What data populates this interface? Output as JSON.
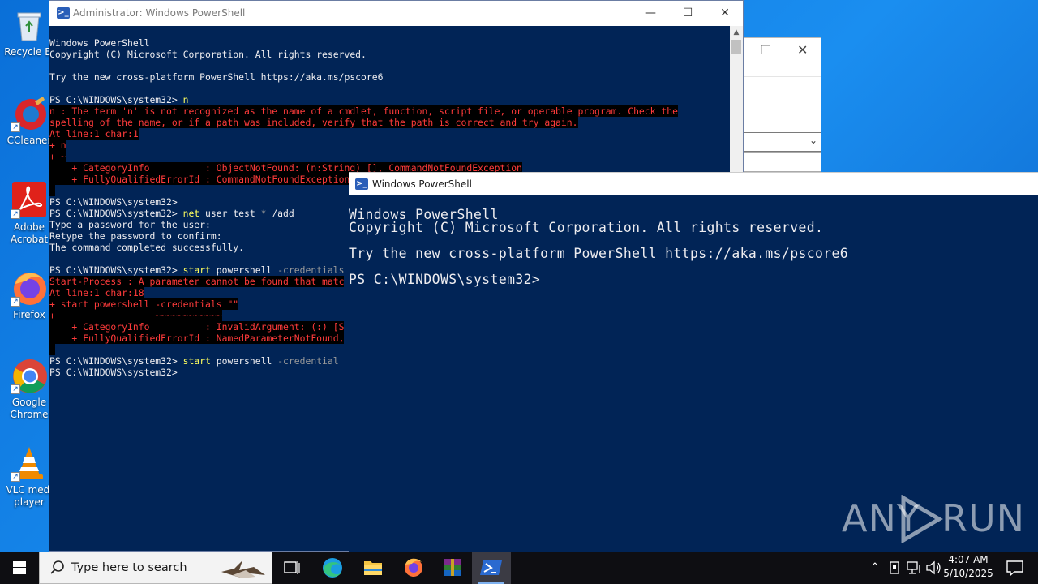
{
  "desktop": {
    "icons": [
      {
        "label": "Recycle Bin",
        "short": "Recycle Bi"
      },
      {
        "label": "CCleaner",
        "short": "CCleaner"
      },
      {
        "label": "Adobe Acrobat",
        "line1": "Adobe",
        "line2": "Acrobat"
      },
      {
        "label": "Firefox",
        "short": "Firefox"
      },
      {
        "label": "Google Chrome",
        "line1": "Google",
        "line2": "Chrome"
      },
      {
        "label": "VLC media player",
        "line1": "VLC medi",
        "line2": "player"
      }
    ]
  },
  "admin_window": {
    "title": "Administrator: Windows PowerShell",
    "lines": {
      "l1": "Windows PowerShell",
      "l2": "Copyright (C) Microsoft Corporation. All rights reserved.",
      "l4": "Try the new cross-platform PowerShell https://aka.ms/pscore6",
      "p1_prompt": "PS C:\\WINDOWS\\system32> ",
      "p1_cmd": "n",
      "e1": "n : The term 'n' is not recognized as the name of a cmdlet, function, script file, or operable program. Check the",
      "e2": "spelling of the name, or if a path was included, verify that the path is correct and try again.",
      "e3": "At line:1 char:1",
      "e4": "+ n",
      "e5": "+ ~",
      "e6": "    + CategoryInfo          : ObjectNotFound: (n:String) [], CommandNotFoundException",
      "e7": "    + FullyQualifiedErrorId : CommandNotFoundException",
      "p2": "PS C:\\WINDOWS\\system32>",
      "p3_prompt": "PS C:\\WINDOWS\\system32> ",
      "p3_cmd1": "net",
      "p3_cmd2": " user test ",
      "p3_cmd3": "*",
      "p3_cmd4": " /add",
      "o1": "Type a password for the user:",
      "o2": "Retype the password to confirm:",
      "o3": "The command completed successfully.",
      "p4_prompt": "PS C:\\WINDOWS\\system32> ",
      "p4_cmd1": "start",
      "p4_cmd2": " powershell ",
      "p4_cmd3": "-credentials",
      "f1": "Start-Process : A parameter cannot be found that matc",
      "f2": "At line:1 char:18",
      "f3": "+ start powershell -credentials \"\"",
      "f4": "+                  ~~~~~~~~~~~~",
      "f5": "    + CategoryInfo          : InvalidArgument: (:) [S",
      "f6": "    + FullyQualifiedErrorId : NamedParameterNotFound,",
      "p5_prompt": "PS C:\\WINDOWS\\system32> ",
      "p5_cmd1": "start",
      "p5_cmd2": " powershell ",
      "p5_cmd3": "-credential",
      "p6": "PS C:\\WINDOWS\\system32>"
    }
  },
  "second_window": {
    "title": "Windows PowerShell",
    "lines": {
      "l1": "Windows PowerShell",
      "l2": "Copyright (C) Microsoft Corporation. All rights reserved.",
      "l4": "Try the new cross-platform PowerShell https://aka.ms/pscore6",
      "l6": "PS C:\\WINDOWS\\system32>"
    }
  },
  "watermark": {
    "left": "ANY",
    "right": "RUN"
  },
  "taskbar": {
    "search_placeholder": "Type here to search",
    "time": "4:07 AM",
    "date": "5/10/2025"
  },
  "colors": {
    "console_bg": "#012456",
    "error_red": "#ff3b3b",
    "command_yellow": "#ffff5e",
    "parameter_gray": "#9a9a9a"
  }
}
